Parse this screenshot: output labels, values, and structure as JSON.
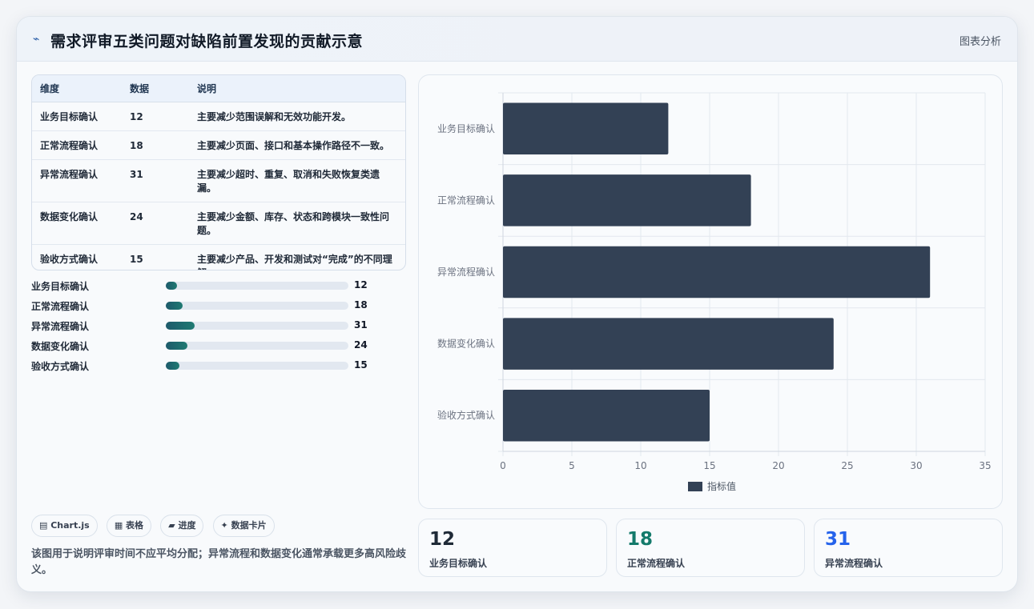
{
  "header": {
    "icon": "sparkline-icon",
    "title": "需求评审五类问题对缺陷前置发现的贡献示意",
    "right_label": "图表分析"
  },
  "table": {
    "headers": [
      "维度",
      "数据",
      "说明"
    ],
    "rows": [
      {
        "dim": "业务目标确认",
        "val": "12",
        "desc": "主要减少范围误解和无效功能开发。"
      },
      {
        "dim": "正常流程确认",
        "val": "18",
        "desc": "主要减少页面、接口和基本操作路径不一致。"
      },
      {
        "dim": "异常流程确认",
        "val": "31",
        "desc": "主要减少超时、重复、取消和失败恢复类遗漏。"
      },
      {
        "dim": "数据变化确认",
        "val": "24",
        "desc": "主要减少金额、库存、状态和跨模块一致性问题。"
      },
      {
        "dim": "验收方式确认",
        "val": "15",
        "desc": "主要减少产品、开发和测试对“完成”的不同理解。"
      }
    ]
  },
  "progress": [
    {
      "label": "业务目标确认",
      "value": 12,
      "fraction": 0.06
    },
    {
      "label": "正常流程确认",
      "value": 18,
      "fraction": 0.09
    },
    {
      "label": "异常流程确认",
      "value": 31,
      "fraction": 0.16
    },
    {
      "label": "数据变化确认",
      "value": 24,
      "fraction": 0.12
    },
    {
      "label": "验收方式确认",
      "value": 15,
      "fraction": 0.075
    }
  ],
  "chips": [
    "▤ Chart.js",
    "▦ 表格",
    "▰ 进度",
    "✦ 数据卡片"
  ],
  "note": "该图用于说明评审时间不应平均分配；异常流程和数据变化通常承载更多高风险歧义。",
  "kpis": [
    {
      "value": "12",
      "label": "业务目标确认",
      "color": "#1f2a37"
    },
    {
      "value": "18",
      "label": "正常流程确认",
      "color": "#137a6b"
    },
    {
      "value": "31",
      "label": "异常流程确认",
      "color": "#2563eb"
    }
  ],
  "chart_data": {
    "type": "bar",
    "orientation": "horizontal",
    "categories": [
      "业务目标确认",
      "正常流程确认",
      "异常流程确认",
      "数据变化确认",
      "验收方式确认"
    ],
    "series": [
      {
        "name": "指标值",
        "values": [
          12,
          18,
          31,
          24,
          15
        ]
      }
    ],
    "xlim": [
      0,
      35
    ],
    "xticks": [
      0,
      5,
      10,
      15,
      20,
      25,
      30,
      35
    ],
    "grid": true,
    "legend": "bottom",
    "bar_color": "#334155"
  }
}
